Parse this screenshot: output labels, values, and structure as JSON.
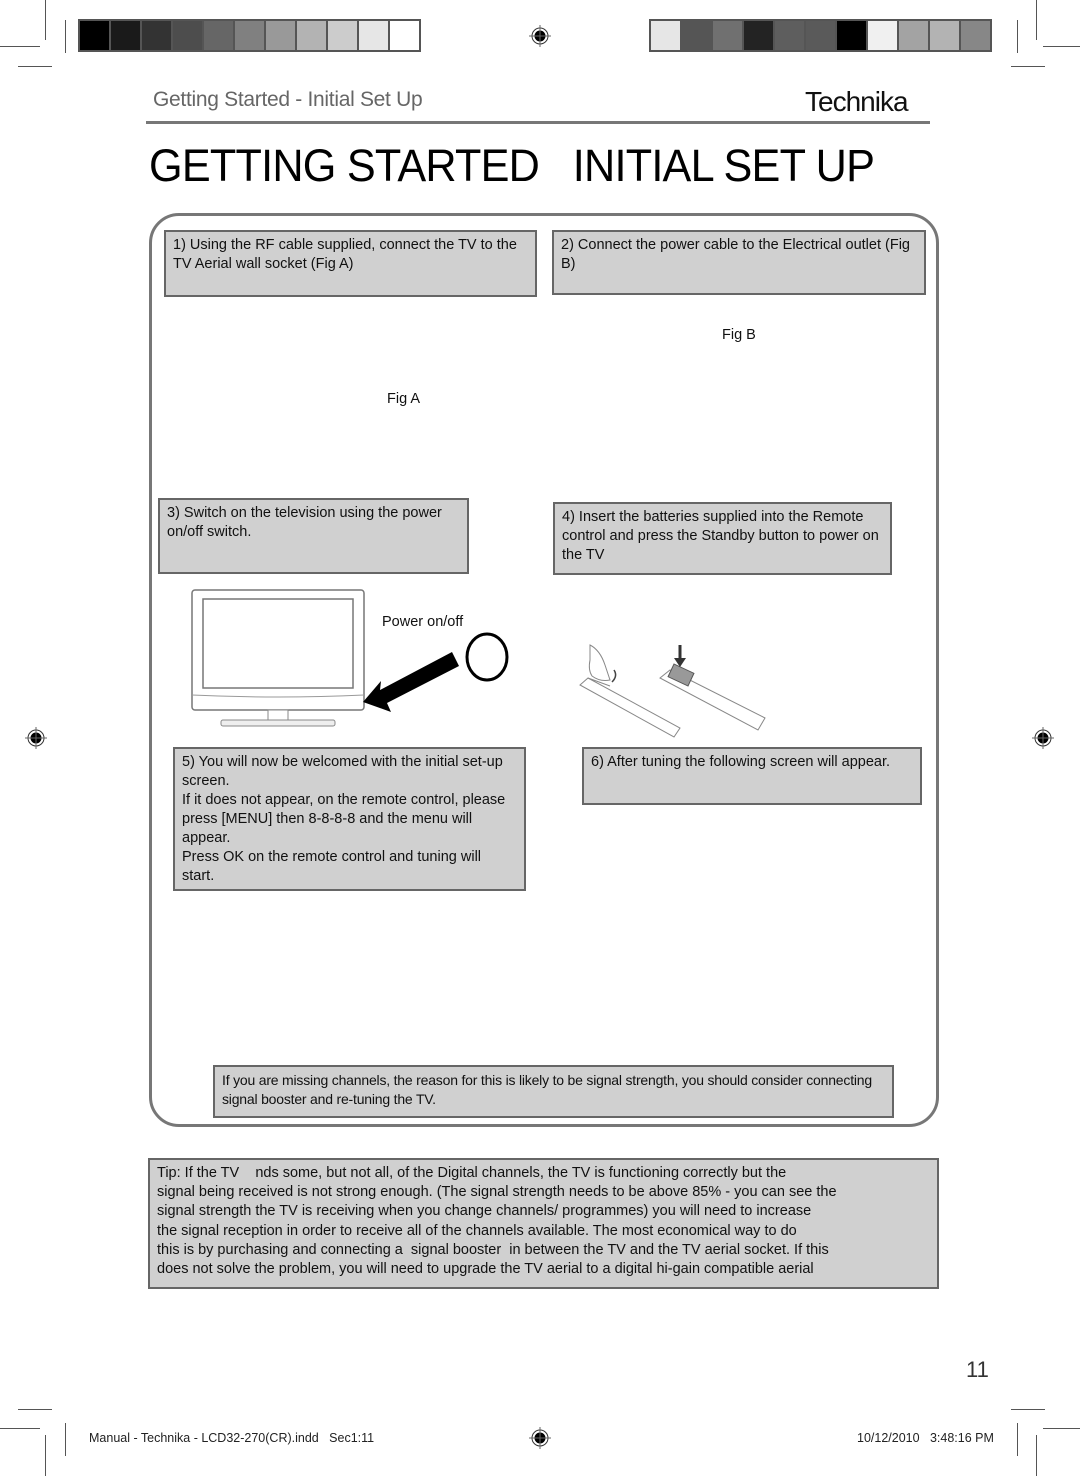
{
  "header": {
    "section_title": "Getting Started - Initial Set Up",
    "brand": "Technika",
    "page_title": "GETTING STARTED   INITIAL SET UP"
  },
  "print_marks": {
    "color_bar_left": [
      "#000000",
      "#1a1a1a",
      "#333333",
      "#4d4d4d",
      "#666666",
      "#808080",
      "#999999",
      "#b3b3b3",
      "#cccccc",
      "#e6e6e6",
      "#ffffff"
    ],
    "color_bar_right": [
      "#e6e6e6",
      "#555555",
      "#707070",
      "#232323",
      "#5e5e5e",
      "#5a5a5a",
      "#000000",
      "#f0f0f0",
      "#a3a3a3",
      "#b3b3b3",
      "#878787"
    ],
    "registration_icon": "crosshair-target"
  },
  "steps": [
    {
      "text": "1) Using the RF cable supplied, connect the TV to the TV Aerial wall socket (Fig A)"
    },
    {
      "text": "2) Connect the power cable to the Electrical outlet (Fig B)"
    },
    {
      "text": "3) Switch on the television using the power on/off switch."
    },
    {
      "text": "4) Insert the batteries supplied into the Remote control and press the Standby button to power on the TV"
    },
    {
      "lines": [
        "5) You will now be welcomed with the initial set-up screen.",
        "If it does not appear, on the remote control, please press [MENU] then 8-8-8-8 and the menu will appear.",
        "Press OK on the remote control and tuning will start."
      ]
    },
    {
      "text": "6) After tuning the following screen will appear."
    }
  ],
  "figures": {
    "fig_a": "Fig A",
    "fig_b": "Fig B",
    "power_label": "Power on/off"
  },
  "notice": "If you are missing channels, the reason for this is likely to be signal strength, you should consider connecting signal booster and re-tuning the TV.",
  "tip_lines": [
    "Tip: If the TV    nds some, but not all, of the Digital channels, the TV is functioning correctly but the",
    "signal being received is not strong enough. (The signal strength needs to be above 85% - you can see the",
    "signal strength the TV is receiving when you change channels/ programmes) you will need to increase",
    "the signal reception in order to receive all of the channels available. The most economical way to do",
    "this is by purchasing and connecting a  signal booster  in between the TV and the TV aerial socket. If this",
    "does not solve the problem, you will need to upgrade the TV aerial to a digital hi-gain compatible aerial"
  ],
  "footer": {
    "page_number": "11",
    "file_info": "Manual - Technika - LCD32-270(CR).indd   Sec1:11",
    "timestamp": "10/12/2010   3:48:16 PM"
  }
}
